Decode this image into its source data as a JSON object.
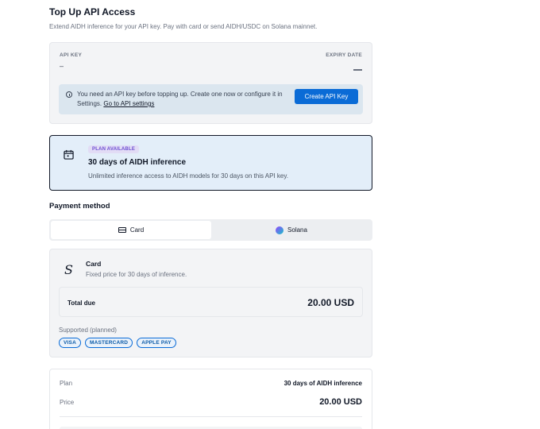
{
  "header": {
    "title": "Top Up API Access",
    "subtitle": "Extend AIDH inference for your API key. Pay with card or send AIDH/USDC on Solana mainnet."
  },
  "api_key": {
    "label": "API KEY",
    "value": "–",
    "expiry_label": "EXPIRY DATE",
    "notice": {
      "icon": "info-icon",
      "text": "You need an API key before topping up. Create one now or configure it in Settings.",
      "link": "Go to API settings",
      "button": "Create API Key"
    }
  },
  "plan": {
    "icon": "calendar-icon",
    "badge": "PLAN AVAILABLE",
    "title": "30 days of AIDH inference",
    "description": "Unlimited inference access to AIDH models for 30 days on this API key."
  },
  "payment": {
    "section_title": "Payment method",
    "tabs": [
      {
        "label": "Card",
        "icon": "credit-card-icon",
        "selected": true
      },
      {
        "label": "Solana",
        "icon": "solana-icon",
        "selected": false
      }
    ],
    "card_panel": {
      "icon": "stripe-s-icon",
      "title": "Card",
      "description": "Fixed price for 30 days of inference.",
      "total_label": "Total due",
      "total_value": "20.00 USD",
      "supported_label": "Supported (planned)",
      "chips": [
        "VISA",
        "MASTERCARD",
        "APPLE PAY"
      ]
    }
  },
  "summary": {
    "plan_label": "Plan",
    "plan_value": "30 days of AIDH inference",
    "price_label": "Price",
    "price_value": "20.00 USD"
  },
  "colors": {
    "primary": "#0a6bd6",
    "plan_bg": "#e3eef9",
    "badge_text": "#6d4fd3",
    "notice_bg": "#dbe6ef"
  }
}
